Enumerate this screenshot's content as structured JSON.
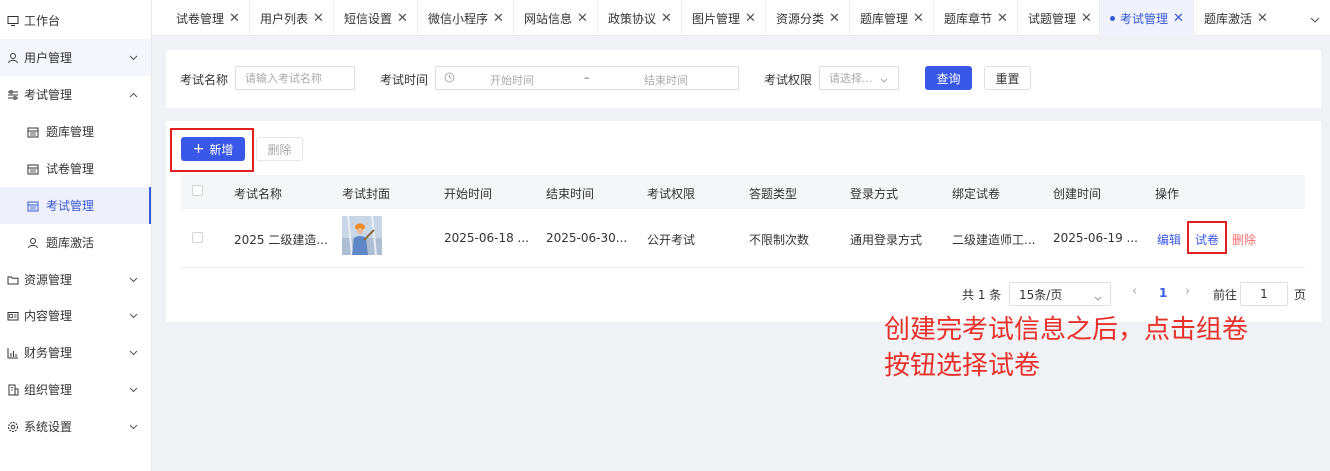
{
  "sidebar": {
    "items": [
      {
        "label": "工作台",
        "icon": "monitor-icon"
      },
      {
        "label": "用户管理",
        "icon": "user-icon"
      },
      {
        "label": "考试管理",
        "icon": "sliders-icon"
      },
      {
        "label": "题库管理",
        "icon": "calendar-icon"
      },
      {
        "label": "试卷管理",
        "icon": "calendar-icon"
      },
      {
        "label": "考试管理",
        "icon": "calendar-icon"
      },
      {
        "label": "题库激活",
        "icon": "user-icon"
      },
      {
        "label": "资源管理",
        "icon": "folder-icon"
      },
      {
        "label": "内容管理",
        "icon": "id-card-icon"
      },
      {
        "label": "财务管理",
        "icon": "bar-chart-icon"
      },
      {
        "label": "组织管理",
        "icon": "building-icon"
      },
      {
        "label": "系统设置",
        "icon": "gear-icon"
      }
    ]
  },
  "tabs": [
    {
      "label": "试卷管理"
    },
    {
      "label": "用户列表"
    },
    {
      "label": "短信设置"
    },
    {
      "label": "微信小程序"
    },
    {
      "label": "网站信息"
    },
    {
      "label": "政策协议"
    },
    {
      "label": "图片管理"
    },
    {
      "label": "资源分类"
    },
    {
      "label": "题库管理"
    },
    {
      "label": "题库章节"
    },
    {
      "label": "试题管理"
    },
    {
      "label": "考试管理"
    },
    {
      "label": "题库激活"
    }
  ],
  "tab_close_glyph": "✕",
  "search": {
    "name_label": "考试名称",
    "name_placeholder": "请输入考试名称",
    "time_label": "考试时间",
    "start_placeholder": "开始时间",
    "range_sep": "–",
    "end_placeholder": "结束时间",
    "perm_label": "考试权限",
    "perm_placeholder": "请选择...",
    "query_button": "查询",
    "reset_button": "重置"
  },
  "toolbar": {
    "add_button": "新增",
    "delete_button": "删除"
  },
  "table": {
    "columns": [
      "考试名称",
      "考试封面",
      "开始时间",
      "结束时间",
      "考试权限",
      "答题类型",
      "登录方式",
      "绑定试卷",
      "创建时间",
      "操作"
    ],
    "rows": [
      {
        "name": "2025 二级建造...",
        "start": "2025-06-18 ...",
        "end": "2025-06-30...",
        "permission": "公开考试",
        "answer_type": "不限制次数",
        "login": "通用登录方式",
        "paper": "二级建造师工...",
        "created": "2025-06-19 ...",
        "actions": {
          "edit": "编辑",
          "paper": "试卷",
          "delete": "删除"
        }
      }
    ]
  },
  "pagination": {
    "total": "共 1 条",
    "page_size": "15条/页",
    "current_page": "1",
    "goto_label": "前往",
    "goto_value": "1",
    "page_unit": "页"
  },
  "annotation": {
    "line1": "创建完考试信息之后，点击组卷",
    "line2": "按钮选择试卷"
  },
  "colors": {
    "primary": "#3a58e8",
    "annotation_red": "#e8302a",
    "delete_red": "#f56c6c"
  }
}
